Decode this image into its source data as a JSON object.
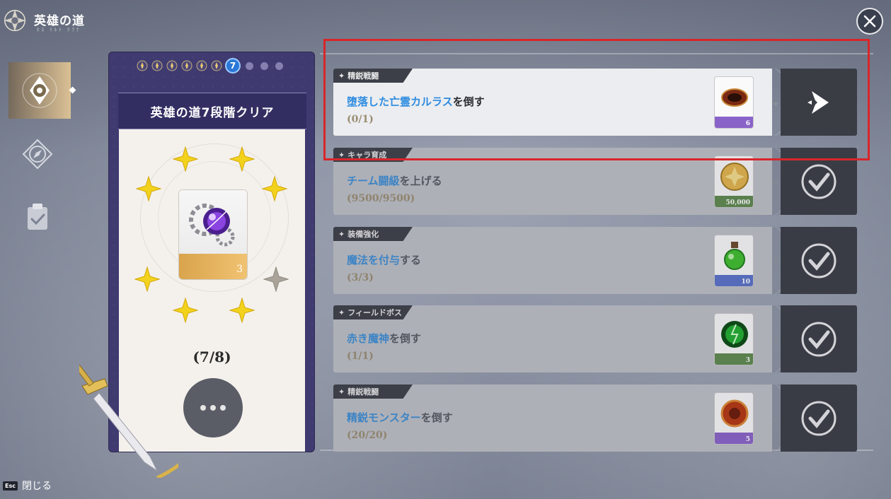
{
  "header": {
    "title": "英雄の道",
    "subtitle": "ﾎﾛ ﾘﾙﾄ ﾂﾗﾅ"
  },
  "close": {
    "icon": "close-icon"
  },
  "sidebar": {
    "tabs": [
      {
        "icon": "hero-road-emblem-icon",
        "active": true
      },
      {
        "icon": "compass-icon",
        "active": false
      },
      {
        "icon": "clipboard-check-icon",
        "active": false
      }
    ]
  },
  "esc": {
    "key": "Esc",
    "label": "閉じる"
  },
  "stage_card": {
    "progress_dots": {
      "completed": 6,
      "current": "7",
      "remaining": 3
    },
    "title": "英雄の道7段階クリア",
    "reward_count": "3",
    "progress": "(7/8)",
    "stars_filled": 7,
    "stars_total": 8
  },
  "quests": [
    {
      "category": "精鋭戦闘",
      "target": "堕落した亡霊カルラス",
      "suffix": "を倒す",
      "progress": "(0/1)",
      "reward_count": "6",
      "strip_color": "#8a63c9",
      "status": "go"
    },
    {
      "category": "キャラ育成",
      "target": "チーム闘級",
      "suffix": "を上げる",
      "progress": "(9500/9500)",
      "reward_count": "50,000",
      "strip_color": "#5f8a4e",
      "status": "done"
    },
    {
      "category": "装備強化",
      "target": "魔法を付与",
      "suffix": "する",
      "progress": "(3/3)",
      "reward_count": "10",
      "strip_color": "#5b72c9",
      "status": "done"
    },
    {
      "category": "フィールドボス",
      "target": "赤き魔神",
      "suffix": "を倒す",
      "progress": "(1/1)",
      "reward_count": "3",
      "strip_color": "#5f8a4e",
      "status": "done"
    },
    {
      "category": "精鋭戦闘",
      "target": "精鋭モンスター",
      "suffix": "を倒す",
      "progress": "(20/20)",
      "reward_count": "5",
      "strip_color": "#8a63c9",
      "status": "done"
    }
  ]
}
